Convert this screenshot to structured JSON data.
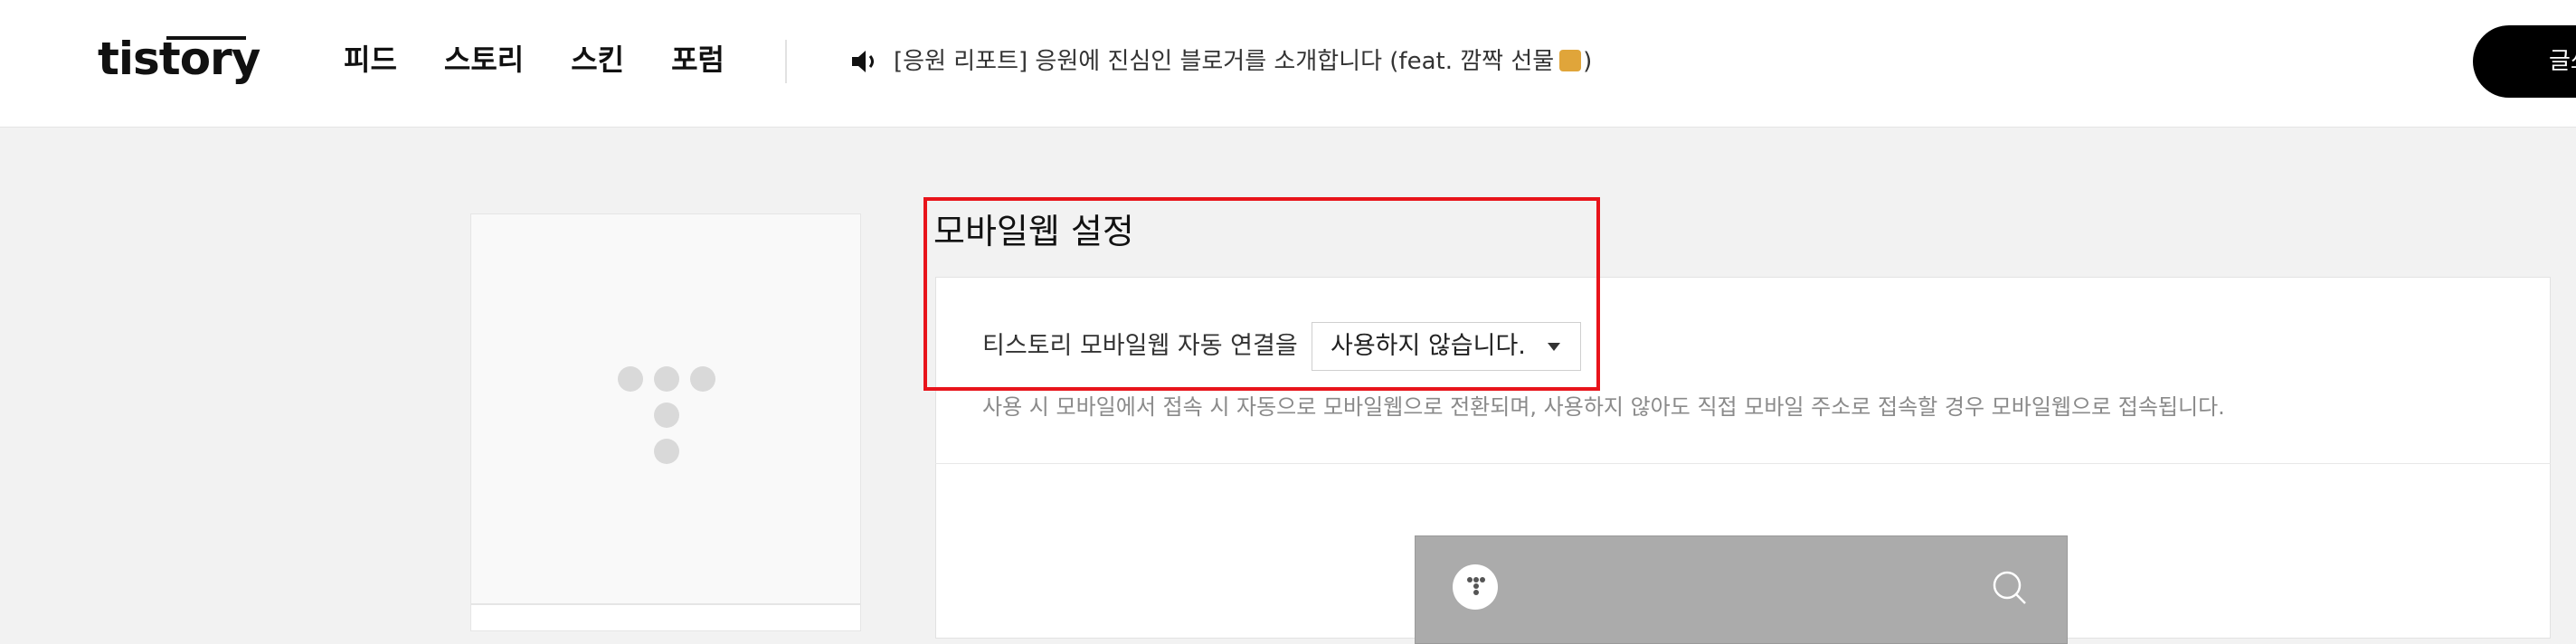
{
  "header": {
    "logo": "tistory",
    "nav": [
      "피드",
      "스토리",
      "스킨",
      "포럼"
    ],
    "notice": {
      "icon": "speaker-icon",
      "text": "[응원 리포트] 응원에 진심인 블로거를 소개합니다 (feat. 깜짝 선물",
      "text_end": ")"
    },
    "write_button": "글쓰"
  },
  "main": {
    "section_title": "모바일웹 설정",
    "setting_label": "티스토리 모바일웹 자동 연결을",
    "select_value": "사용하지 않습니다.",
    "help_text": "사용 시 모바일에서 접속 시 자동으로 모바일웹으로 전환되며, 사용하지 않아도 직접 모바일 주소로 접속할 경우 모바일웹으로 접속됩니다."
  },
  "colors": {
    "highlight": "#e8141b",
    "header_bg": "#ffffff",
    "page_bg": "#f2f2f2",
    "preview_bar": "#ababab"
  }
}
